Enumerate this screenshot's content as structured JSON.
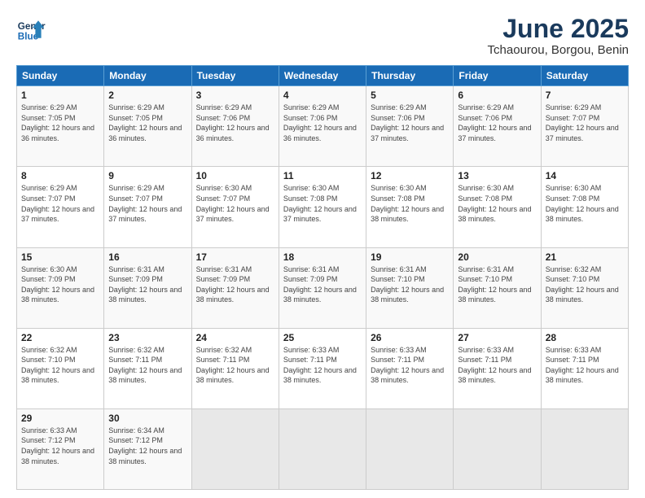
{
  "logo": {
    "line1": "General",
    "line2": "Blue"
  },
  "title": "June 2025",
  "subtitle": "Tchaourou, Borgou, Benin",
  "headers": [
    "Sunday",
    "Monday",
    "Tuesday",
    "Wednesday",
    "Thursday",
    "Friday",
    "Saturday"
  ],
  "weeks": [
    [
      {
        "day": "1",
        "rise": "6:29 AM",
        "set": "7:05 PM",
        "daylight": "12 hours and 36 minutes."
      },
      {
        "day": "2",
        "rise": "6:29 AM",
        "set": "7:05 PM",
        "daylight": "12 hours and 36 minutes."
      },
      {
        "day": "3",
        "rise": "6:29 AM",
        "set": "7:06 PM",
        "daylight": "12 hours and 36 minutes."
      },
      {
        "day": "4",
        "rise": "6:29 AM",
        "set": "7:06 PM",
        "daylight": "12 hours and 36 minutes."
      },
      {
        "day": "5",
        "rise": "6:29 AM",
        "set": "7:06 PM",
        "daylight": "12 hours and 37 minutes."
      },
      {
        "day": "6",
        "rise": "6:29 AM",
        "set": "7:06 PM",
        "daylight": "12 hours and 37 minutes."
      },
      {
        "day": "7",
        "rise": "6:29 AM",
        "set": "7:07 PM",
        "daylight": "12 hours and 37 minutes."
      }
    ],
    [
      {
        "day": "8",
        "rise": "6:29 AM",
        "set": "7:07 PM",
        "daylight": "12 hours and 37 minutes."
      },
      {
        "day": "9",
        "rise": "6:29 AM",
        "set": "7:07 PM",
        "daylight": "12 hours and 37 minutes."
      },
      {
        "day": "10",
        "rise": "6:30 AM",
        "set": "7:07 PM",
        "daylight": "12 hours and 37 minutes."
      },
      {
        "day": "11",
        "rise": "6:30 AM",
        "set": "7:08 PM",
        "daylight": "12 hours and 37 minutes."
      },
      {
        "day": "12",
        "rise": "6:30 AM",
        "set": "7:08 PM",
        "daylight": "12 hours and 38 minutes."
      },
      {
        "day": "13",
        "rise": "6:30 AM",
        "set": "7:08 PM",
        "daylight": "12 hours and 38 minutes."
      },
      {
        "day": "14",
        "rise": "6:30 AM",
        "set": "7:08 PM",
        "daylight": "12 hours and 38 minutes."
      }
    ],
    [
      {
        "day": "15",
        "rise": "6:30 AM",
        "set": "7:09 PM",
        "daylight": "12 hours and 38 minutes."
      },
      {
        "day": "16",
        "rise": "6:31 AM",
        "set": "7:09 PM",
        "daylight": "12 hours and 38 minutes."
      },
      {
        "day": "17",
        "rise": "6:31 AM",
        "set": "7:09 PM",
        "daylight": "12 hours and 38 minutes."
      },
      {
        "day": "18",
        "rise": "6:31 AM",
        "set": "7:09 PM",
        "daylight": "12 hours and 38 minutes."
      },
      {
        "day": "19",
        "rise": "6:31 AM",
        "set": "7:10 PM",
        "daylight": "12 hours and 38 minutes."
      },
      {
        "day": "20",
        "rise": "6:31 AM",
        "set": "7:10 PM",
        "daylight": "12 hours and 38 minutes."
      },
      {
        "day": "21",
        "rise": "6:32 AM",
        "set": "7:10 PM",
        "daylight": "12 hours and 38 minutes."
      }
    ],
    [
      {
        "day": "22",
        "rise": "6:32 AM",
        "set": "7:10 PM",
        "daylight": "12 hours and 38 minutes."
      },
      {
        "day": "23",
        "rise": "6:32 AM",
        "set": "7:11 PM",
        "daylight": "12 hours and 38 minutes."
      },
      {
        "day": "24",
        "rise": "6:32 AM",
        "set": "7:11 PM",
        "daylight": "12 hours and 38 minutes."
      },
      {
        "day": "25",
        "rise": "6:33 AM",
        "set": "7:11 PM",
        "daylight": "12 hours and 38 minutes."
      },
      {
        "day": "26",
        "rise": "6:33 AM",
        "set": "7:11 PM",
        "daylight": "12 hours and 38 minutes."
      },
      {
        "day": "27",
        "rise": "6:33 AM",
        "set": "7:11 PM",
        "daylight": "12 hours and 38 minutes."
      },
      {
        "day": "28",
        "rise": "6:33 AM",
        "set": "7:11 PM",
        "daylight": "12 hours and 38 minutes."
      }
    ],
    [
      {
        "day": "29",
        "rise": "6:33 AM",
        "set": "7:12 PM",
        "daylight": "12 hours and 38 minutes."
      },
      {
        "day": "30",
        "rise": "6:34 AM",
        "set": "7:12 PM",
        "daylight": "12 hours and 38 minutes."
      },
      null,
      null,
      null,
      null,
      null
    ]
  ]
}
